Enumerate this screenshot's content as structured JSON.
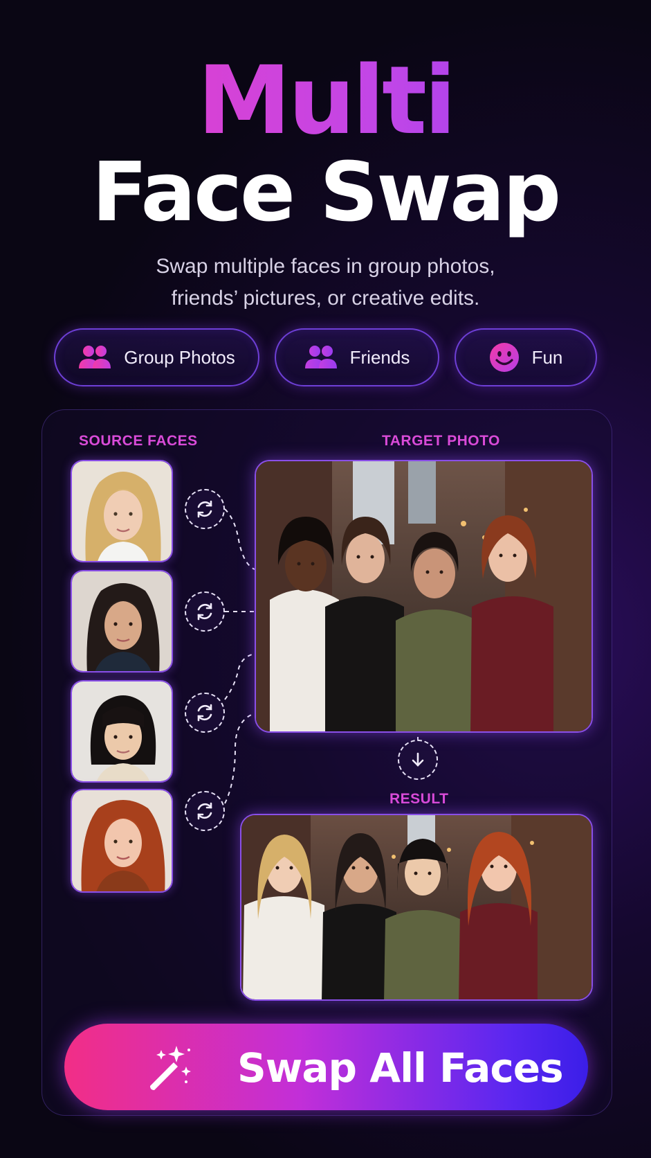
{
  "header": {
    "title_line1": "Multi",
    "title_line2": "Face Swap",
    "subtitle_line1": "Swap multiple faces in group photos,",
    "subtitle_line2": "friends’ pictures, or creative edits."
  },
  "chips": [
    {
      "label": "Group Photos",
      "icon": "group-icon"
    },
    {
      "label": "Friends",
      "icon": "group-icon"
    },
    {
      "label": "Fun",
      "icon": "smiley-icon"
    }
  ],
  "workspace": {
    "source_label": "SOURCE FACES",
    "target_label": "TARGET PHOTO",
    "result_label": "RESULT"
  },
  "cta": {
    "label": "Swap All Faces",
    "icon": "magic-wand-icon"
  },
  "colors": {
    "accent_pink": "#f03ec0",
    "accent_purple": "#8a3cf0",
    "background": "#0a0614",
    "border_purple": "#8a4fe8"
  }
}
